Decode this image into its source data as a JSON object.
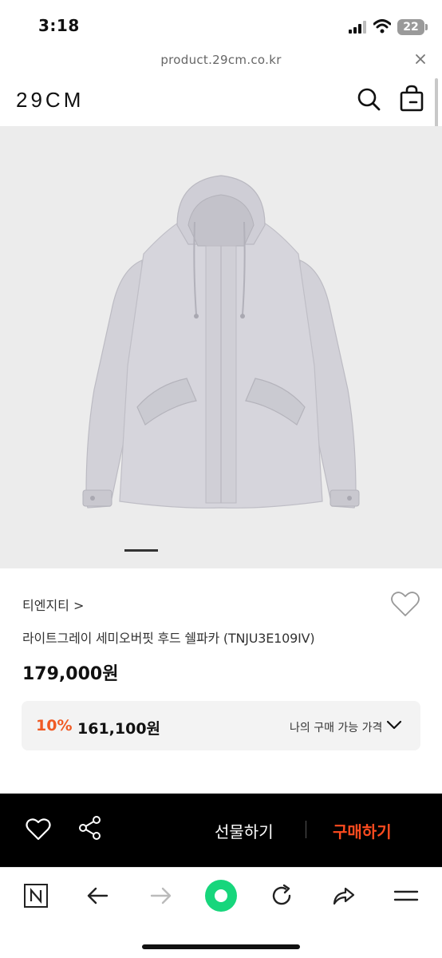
{
  "status_bar": {
    "time": "3:18",
    "battery": "22"
  },
  "browser": {
    "url": "product.29cm.co.kr"
  },
  "header": {
    "logo": "29CM"
  },
  "product": {
    "brand": "티엔지티 >",
    "name": "라이트그레이 세미오버핏 후드 쉘파카 (TNJU3E109IV)",
    "price": "179,000원",
    "discount_percent": "10%",
    "discount_price": "161,100원",
    "my_price_label": "나의 구매 가능 가격",
    "image_index": 1
  },
  "actions": {
    "gift_label": "선물하기",
    "buy_label": "구매하기"
  },
  "colors": {
    "accent": "#f05a24",
    "buy": "#ff4b1f",
    "jacket": "#d4d3d9"
  },
  "icons": [
    "search-icon",
    "shopping-bag-icon",
    "heart-icon",
    "share-icon",
    "chevron-down-icon",
    "naver-icon",
    "back-arrow-icon",
    "forward-arrow-icon",
    "green-dot-icon",
    "refresh-icon",
    "share-forward-icon",
    "menu-icon"
  ]
}
